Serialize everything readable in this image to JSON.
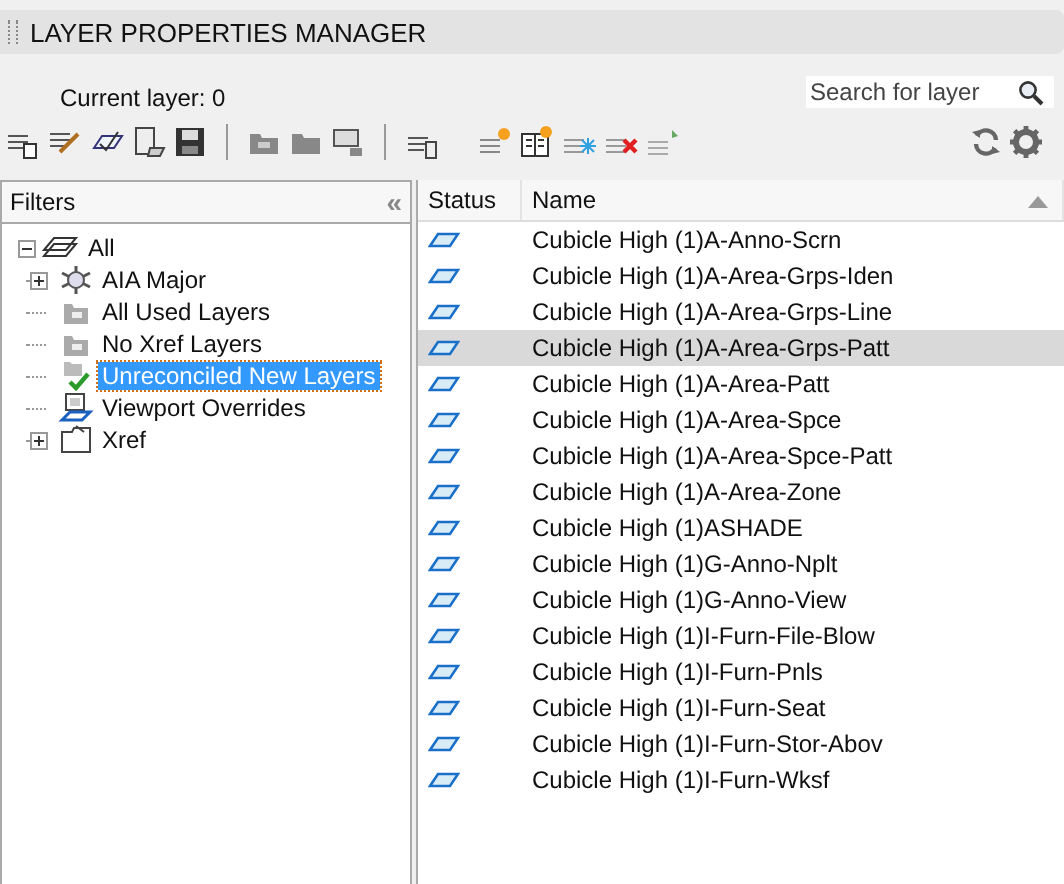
{
  "window": {
    "title": "LAYER PROPERTIES MANAGER"
  },
  "current_layer": "Current layer: 0",
  "search": {
    "placeholder": "Search for layer"
  },
  "filters": {
    "title": "Filters",
    "collapse": "«",
    "tree": [
      {
        "label": "All",
        "kind": "all",
        "expanded": true,
        "selected": false,
        "children": [
          {
            "label": "AIA Major",
            "kind": "group",
            "expanded": false,
            "selected": false
          },
          {
            "label": "All Used Layers",
            "kind": "filter",
            "selected": false
          },
          {
            "label": "No Xref Layers",
            "kind": "filter",
            "selected": false
          },
          {
            "label": "Unreconciled New Layers",
            "kind": "check",
            "selected": true
          },
          {
            "label": "Viewport Overrides",
            "kind": "viewport",
            "selected": false
          },
          {
            "label": "Xref",
            "kind": "xref",
            "expanded": false,
            "selected": false
          }
        ]
      }
    ]
  },
  "table": {
    "columns": [
      "Status",
      "Name"
    ],
    "rows": [
      {
        "name": "Cubicle High (1)A-Anno-Scrn",
        "selected": false
      },
      {
        "name": "Cubicle High (1)A-Area-Grps-Iden",
        "selected": false
      },
      {
        "name": "Cubicle High (1)A-Area-Grps-Line",
        "selected": false
      },
      {
        "name": "Cubicle High (1)A-Area-Grps-Patt",
        "selected": true
      },
      {
        "name": "Cubicle High (1)A-Area-Patt",
        "selected": false
      },
      {
        "name": "Cubicle High (1)A-Area-Spce",
        "selected": false
      },
      {
        "name": "Cubicle High (1)A-Area-Spce-Patt",
        "selected": false
      },
      {
        "name": "Cubicle High (1)A-Area-Zone",
        "selected": false
      },
      {
        "name": "Cubicle High (1)ASHADE",
        "selected": false
      },
      {
        "name": "Cubicle High (1)G-Anno-Nplt",
        "selected": false
      },
      {
        "name": "Cubicle High (1)G-Anno-View",
        "selected": false
      },
      {
        "name": "Cubicle High (1)I-Furn-File-Blow",
        "selected": false
      },
      {
        "name": "Cubicle High (1)I-Furn-Pnls",
        "selected": false
      },
      {
        "name": "Cubicle High (1)I-Furn-Seat",
        "selected": false
      },
      {
        "name": "Cubicle High (1)I-Furn-Stor-Abov",
        "selected": false
      },
      {
        "name": "Cubicle High (1)I-Furn-Wksf",
        "selected": false
      }
    ]
  }
}
